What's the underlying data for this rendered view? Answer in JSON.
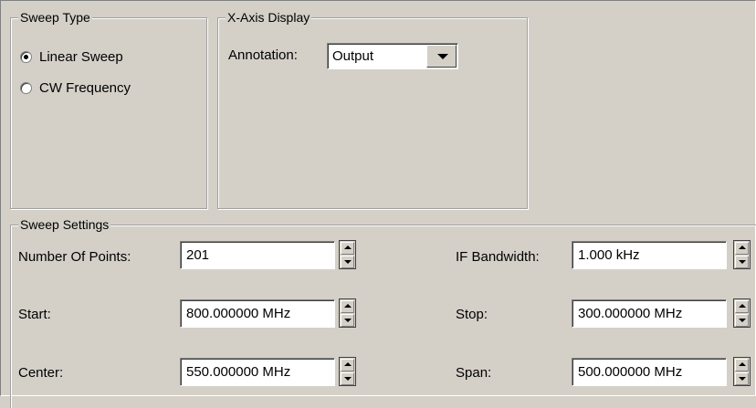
{
  "sweep_type": {
    "title": "Sweep Type",
    "options": [
      {
        "label": "Linear Sweep",
        "selected": true
      },
      {
        "label": "CW Frequency",
        "selected": false
      }
    ]
  },
  "x_axis_display": {
    "title": "X-Axis Display",
    "annotation_label": "Annotation:",
    "annotation_value": "Output"
  },
  "sweep_settings": {
    "title": "Sweep Settings",
    "number_of_points": {
      "label": "Number Of Points:",
      "value": "201"
    },
    "start": {
      "label": "Start:",
      "value": "800.000000 MHz"
    },
    "center": {
      "label": "Center:",
      "value": "550.000000 MHz"
    },
    "if_bandwidth": {
      "label": "IF Bandwidth:",
      "value": "1.000 kHz"
    },
    "stop": {
      "label": "Stop:",
      "value": "300.000000 MHz"
    },
    "span": {
      "label": "Span:",
      "value": "500.000000 MHz"
    }
  }
}
